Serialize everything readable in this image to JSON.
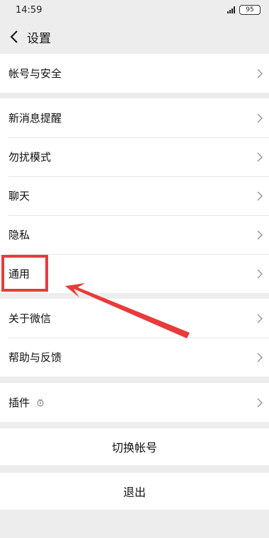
{
  "status_bar": {
    "time": "14:59",
    "battery": "95"
  },
  "nav": {
    "title": "设置",
    "back_icon": "chevron-left-icon"
  },
  "groups": [
    {
      "items": [
        {
          "label": "帐号与安全"
        }
      ]
    },
    {
      "items": [
        {
          "label": "新消息提醒"
        },
        {
          "label": "勿扰模式"
        },
        {
          "label": "聊天"
        },
        {
          "label": "隐私"
        },
        {
          "label": "通用"
        }
      ]
    },
    {
      "items": [
        {
          "label": "关于微信"
        },
        {
          "label": "帮助与反馈"
        }
      ]
    },
    {
      "items": [
        {
          "label": "插件",
          "badge_icon": "plugin-icon"
        }
      ]
    }
  ],
  "actions": {
    "switch_account": "切换帐号",
    "logout": "退出"
  },
  "annotation": {
    "color": "#e83b3b",
    "highlight_target": "通用"
  }
}
